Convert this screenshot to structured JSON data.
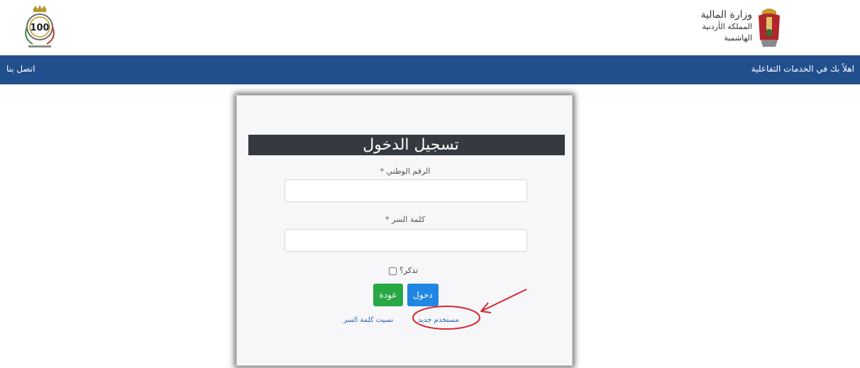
{
  "header": {
    "ministry_name": "وزارة المالية",
    "kingdom_name": "المملكة الأردنية الهاشمية",
    "centennial_number": "100"
  },
  "navbar": {
    "welcome_text": "اهلاً بك في الخدمات التفاعلية",
    "contact_link": "اتصل بنا",
    "color": "#214f8e"
  },
  "login": {
    "title": "تسجيل الدخول",
    "national_id_label": "الرقم الوطني *",
    "national_id_value": "",
    "password_label": "كلمة السر *",
    "password_value": "",
    "remember_label": "تذكر؟",
    "remember_checked": false,
    "login_button": "دخول",
    "back_button": "عودة",
    "forgot_password_link": "نسيت كلمة السر",
    "new_user_link": "مستخدم جديد"
  },
  "colors": {
    "login_button": "#1f86e4",
    "back_button": "#28a745",
    "title_bar": "#343a40",
    "annotation": "#d8262e"
  },
  "annotation": {
    "shape": "red-arrow-and-circle",
    "target": "new_user_link"
  }
}
